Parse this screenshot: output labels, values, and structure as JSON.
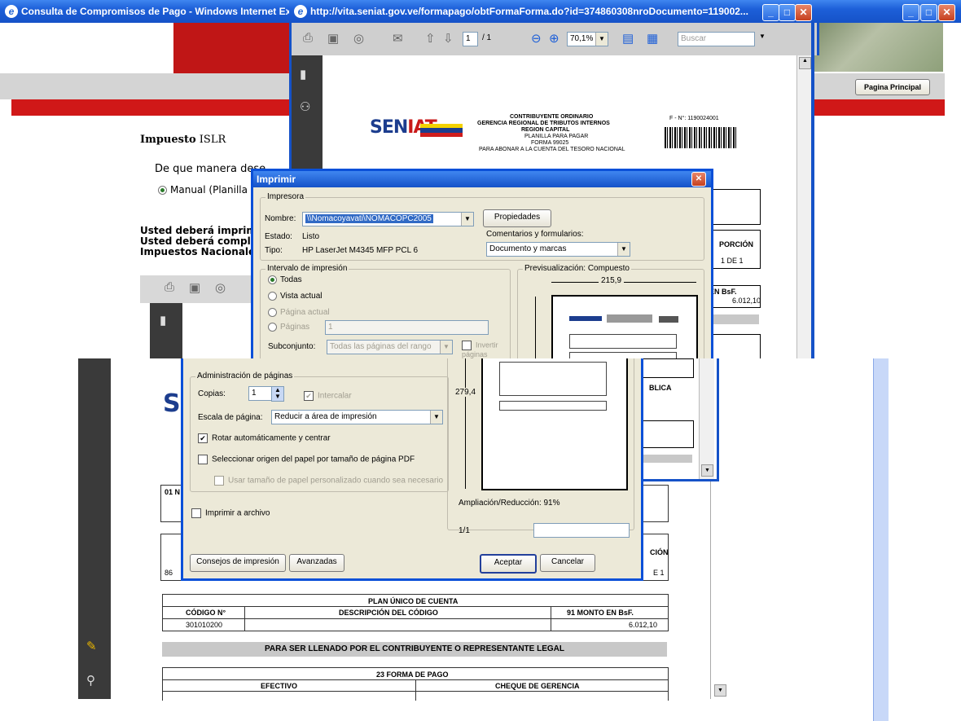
{
  "ie_window": {
    "title": "Consulta de Compromisos de Pago - Windows Internet Exp",
    "impuesto_label": "Impuesto",
    "impuesto_value": "ISLR",
    "question": "De que manera dese",
    "radio_manual": "Manual (Planilla",
    "line1": "Usted deberá imprim",
    "line2": "Usted deberá compl",
    "line3": "Impuestos Nacionale",
    "pagina_principal": "Pagina Principal"
  },
  "pdf_window": {
    "title": "http://vita.seniat.gov.ve/formapago/obtFormaForma.do?id=374860308nroDocumento=119002...",
    "page_current": "1",
    "page_total": "/ 1",
    "zoom": "70,1%",
    "search_placeholder": "Buscar"
  },
  "pdf_doc_header": {
    "contribuyente": "CONTRIBUYENTE ORDINARIO",
    "gerencia": "GERENCIA REGIONAL DE TRIBUTOS INTERNOS",
    "region": "REGION CAPITAL",
    "planilla": "PLANILLA PARA PAGAR",
    "forma": "FORMA 99025",
    "abonar": "PARA ABONAR A LA CUENTA DEL TESORO NACIONAL",
    "f_number": "F - N°: 1190024001",
    "porcion": "PORCIÓN",
    "porcion_value": "1 DE 1",
    "en_bsf": "EN BsF.",
    "monto": "6.012,10",
    "publica": "BLICA"
  },
  "print_dialog": {
    "title": "Imprimir",
    "impresora_group": "Impresora",
    "nombre_label": "Nombre:",
    "nombre_value": "\\\\Nomacoyavati\\NOMACOPC2005",
    "propiedades": "Propiedades",
    "estado_label": "Estado:",
    "estado_value": "Listo",
    "tipo_label": "Tipo:",
    "tipo_value": "HP LaserJet M4345 MFP PCL 6",
    "comentarios_label": "Comentarios y formularios:",
    "comentarios_value": "Documento y marcas",
    "intervalo_group": "Intervalo de impresión",
    "todas": "Todas",
    "vista_actual": "Vista actual",
    "pagina_actual": "Página actual",
    "paginas": "Páginas",
    "paginas_value": "1",
    "subconjunto_label": "Subconjunto:",
    "subconjunto_value": "Todas las páginas del rango",
    "invertir": "Invertir páginas",
    "previsualizacion": "Previsualización: Compuesto",
    "width_dim": "215,9",
    "height_dim": "279,4",
    "admin_group": "Administración de páginas",
    "copias_label": "Copias:",
    "copias_value": "1",
    "intercalar": "Intercalar",
    "escala_label": "Escala de página:",
    "escala_value": "Reducir a área de impresión",
    "rotar": "Rotar automáticamente y centrar",
    "seleccionar_origen": "Seleccionar origen del papel por tamaño de página PDF",
    "usar_tamano": "Usar tamaño de papel personalizado cuando sea necesario",
    "imprimir_archivo": "Imprimir a archivo",
    "ampliacion": "Ampliación/Reducción:  91%",
    "page_indicator": "1/1",
    "consejos": "Consejos de impresión",
    "avanzadas": "Avanzadas",
    "aceptar": "Aceptar",
    "cancelar": "Cancelar"
  },
  "lower_doc": {
    "row01": "01 N",
    "cion": "CIÓN",
    "left_num": "86",
    "right_num": "E 1",
    "plan_title": "PLAN ÚNICO DE CUENTA",
    "codigo_header": "CÓDIGO N°",
    "descripcion_header": "DESCRIPCIÓN DEL CÓDIGO",
    "monto_header": "91 MONTO EN BsF.",
    "codigo_value": "301010200",
    "monto_value": "6.012,10",
    "llenado": "PARA SER LLENADO POR EL CONTRIBUYENTE O REPRESENTANTE LEGAL",
    "forma_pago": "23 FORMA DE PAGO",
    "efectivo": "EFECTIVO",
    "cheque": "CHEQUE DE GERENCIA"
  },
  "logo_text": "SENIAT",
  "colors": {
    "xp_blue": "#1552c8",
    "seniat_red": "#d01818",
    "dialog_bg": "#ece9d8"
  }
}
